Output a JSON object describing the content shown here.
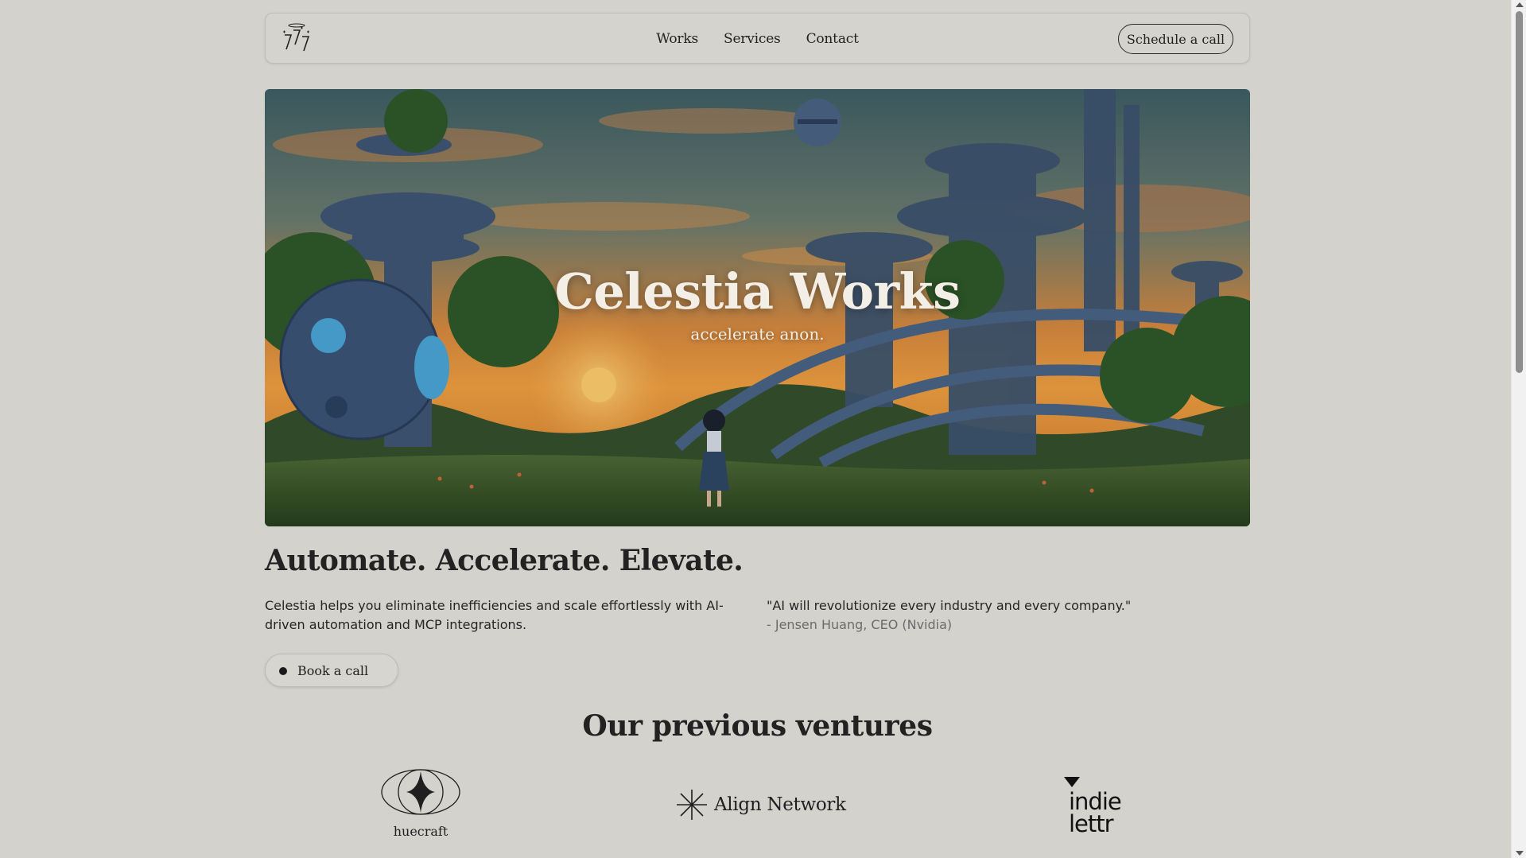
{
  "nav": {
    "links": [
      "Works",
      "Services",
      "Contact"
    ],
    "cta_label": "Schedule a call"
  },
  "hero": {
    "title": "Celestia Works",
    "subtitle": "accelerate anon."
  },
  "main": {
    "headline": "Automate. Accelerate. Elevate.",
    "description": "Celestia helps you eliminate inefficiencies and scale effortlessly with AI-driven automation and MCP integrations.",
    "quote_text": "\"AI will revolutionize every industry and every company.\"",
    "quote_author": "- Jensen Huang, CEO (Nvidia)",
    "book_label": "Book a call"
  },
  "ventures": {
    "title": "Our previous ventures",
    "items": [
      {
        "name": "huecraft",
        "icon": "four-point-star-ellipse-icon"
      },
      {
        "name": "Align Network",
        "icon": "asterisk-star-icon"
      },
      {
        "name_line1": "indie",
        "name_line2": "lettr",
        "icon": "triangle-icon"
      }
    ]
  },
  "colors": {
    "background": "#d3d2cd",
    "text": "#1f1f1f",
    "muted": "#6b6b6b"
  }
}
